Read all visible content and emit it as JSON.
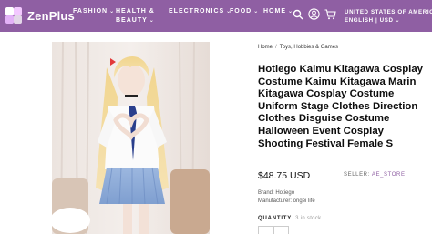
{
  "header": {
    "logo_text": "ZenPlus",
    "nav": [
      {
        "line1": "FASHION",
        "line2": ""
      },
      {
        "line1": "HEALTH &",
        "line2": "BEAUTY"
      },
      {
        "line1": "ELECTRONICS",
        "line2": ""
      },
      {
        "line1": "FOOD",
        "line2": ""
      },
      {
        "line1": "HOME",
        "line2": ""
      }
    ],
    "icons": [
      "search-icon",
      "user-icon",
      "cart-icon",
      "chevron-down-icon"
    ],
    "locale_line1": "UNITED STATES OF AMERICA",
    "locale_line2": "ENGLISH | USD",
    "colors": {
      "nav_bg": "#8f5fa3",
      "accent": "#8f5fa3"
    }
  },
  "breadcrumb": {
    "home": "Home",
    "separator": "/",
    "category": "Toys, Hobbies & Games"
  },
  "product": {
    "title": "Hotiego Kaimu Kitagawa Cosplay Costume Kaimu Kitagawa Marin Kitagawa Cosplay Costume Uniform Stage Clothes Direction Clothes Disguise Costume Halloween Event Cosplay Shooting Festival Female S",
    "price": "$48.75 USD",
    "seller_label": "SELLER:",
    "seller_name": "AE_STORE",
    "brand": "Brand: Hotiego",
    "manufacturer": "Manufacturer: origei life",
    "quantity_label": "QUANTITY",
    "stock_text": "3 in stock"
  }
}
